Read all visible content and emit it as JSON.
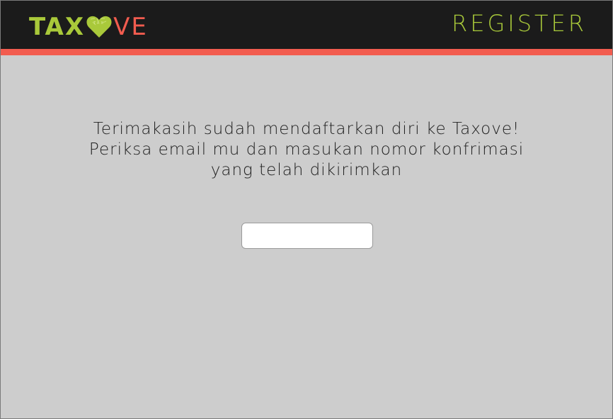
{
  "header": {
    "logo": {
      "text_left": "TAX",
      "text_right": "VE",
      "heart_icon": "heart-icon",
      "left_color": "#a9c93a",
      "right_color": "#f25c4f"
    },
    "register_label": "REGISTER"
  },
  "main": {
    "message_lines": [
      "Terimakasih sudah mendaftarkan diri ke Taxove!",
      "Periksa email mu dan masukan nomor konfrimasi",
      "yang telah dikirimkan"
    ],
    "confirmation_input": {
      "value": "",
      "placeholder": ""
    }
  },
  "colors": {
    "header_background": "#1b1b1b",
    "accent": "#f25c4f",
    "brand_green": "#a9c93a",
    "page_background": "#cdcdcd"
  }
}
